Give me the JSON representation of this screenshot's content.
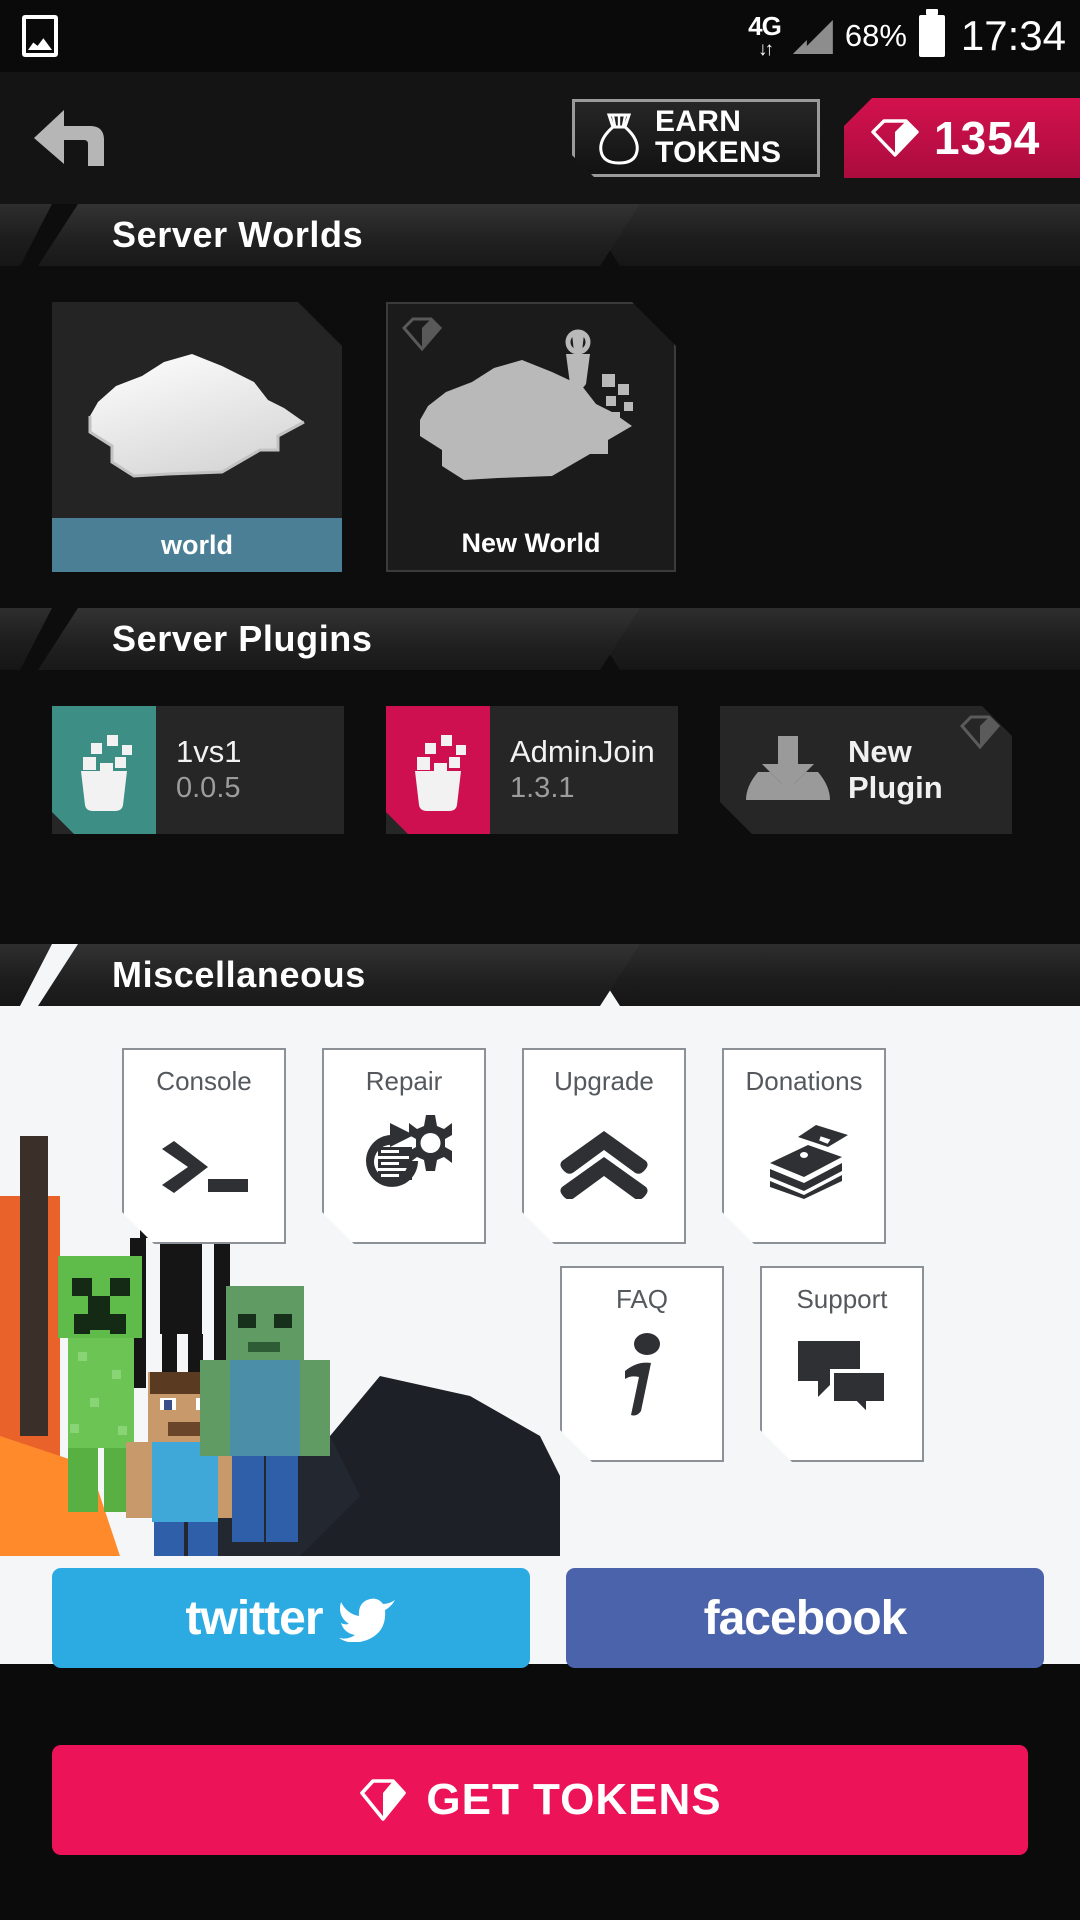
{
  "status_bar": {
    "gallery_icon": "image-icon",
    "network_type": "4G",
    "data_arrows": "↓↑",
    "signal_icon": "signal-bars-icon",
    "battery_percent": "68%",
    "battery_icon": "battery-icon",
    "clock": "17:34"
  },
  "topbar": {
    "back_icon": "back-arrow-icon",
    "earn_tokens": {
      "icon": "money-sack-icon",
      "line1": "EARN",
      "line2": "TOKENS"
    },
    "gem_badge": {
      "icon": "gem-icon",
      "count": "1354"
    }
  },
  "sections": {
    "worlds": {
      "title": "Server Worlds",
      "cards": [
        {
          "label": "world",
          "selected": true,
          "icon": "world-map-icon",
          "premium": false
        },
        {
          "label": "New World",
          "selected": false,
          "icon": "new-world-shovel-icon",
          "premium": true
        }
      ]
    },
    "plugins": {
      "title": "Server Plugins",
      "cards": [
        {
          "name": "1vs1",
          "version": "0.0.5",
          "accent": "#3d8e85",
          "icon": "plugin-bucket-icon"
        },
        {
          "name": "AdminJoin",
          "version": "1.3.1",
          "accent": "#cf1050",
          "icon": "plugin-bucket-icon"
        }
      ],
      "new_plugin": {
        "line1": "New",
        "line2": "Plugin",
        "icon": "download-icon",
        "premium": true
      }
    },
    "misc": {
      "title": "Miscellaneous",
      "tiles_row1": [
        {
          "label": "Console",
          "icon": "terminal-prompt-icon"
        },
        {
          "label": "Repair",
          "icon": "gear-refresh-icon"
        },
        {
          "label": "Upgrade",
          "icon": "double-chevron-up-icon"
        },
        {
          "label": "Donations",
          "icon": "money-stack-icon"
        }
      ],
      "tiles_row2": [
        {
          "label": "FAQ",
          "icon": "info-icon"
        },
        {
          "label": "Support",
          "icon": "chat-bubbles-icon"
        }
      ]
    }
  },
  "socials": [
    {
      "label": "twitter",
      "icon": "twitter-bird-icon",
      "color": "#2cabe2"
    },
    {
      "label": "facebook",
      "icon": "facebook-icon",
      "color": "#4a63ab"
    }
  ],
  "footer": {
    "get_tokens": {
      "label": "GET TOKENS",
      "icon": "gem-icon",
      "color": "#ed1359"
    }
  },
  "colors": {
    "accent_pink": "#ed1359",
    "gem_badge": "#cf1050",
    "selected_world": "#4b7f95",
    "plugin_teal": "#3d8e85",
    "dark_bg": "#0d0d0d",
    "light_bg": "#f4f6f7"
  }
}
